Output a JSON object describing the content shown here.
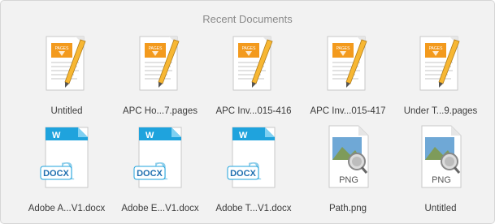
{
  "panel": {
    "title": "Recent Documents"
  },
  "documents": [
    {
      "name": "Untitled",
      "kind": "pages",
      "icon": "pages-document-icon"
    },
    {
      "name": "APC Ho...7.pages",
      "kind": "pages",
      "icon": "pages-document-icon"
    },
    {
      "name": "APC Inv...015-416",
      "kind": "pages",
      "icon": "pages-document-icon"
    },
    {
      "name": "APC Inv...015-417",
      "kind": "pages",
      "icon": "pages-document-icon"
    },
    {
      "name": "Under T...9.pages",
      "kind": "pages",
      "icon": "pages-document-icon"
    },
    {
      "name": "Adobe A...V1.docx",
      "kind": "docx",
      "icon": "word-docx-icon",
      "badge": "DOCX"
    },
    {
      "name": "Adobe E...V1.docx",
      "kind": "docx",
      "icon": "word-docx-icon",
      "badge": "DOCX"
    },
    {
      "name": "Adobe T...V1.docx",
      "kind": "docx",
      "icon": "word-docx-icon",
      "badge": "DOCX"
    },
    {
      "name": "Path.png",
      "kind": "png",
      "icon": "png-preview-icon",
      "badge": "PNG"
    },
    {
      "name": "Untitled",
      "kind": "png",
      "icon": "png-preview-icon",
      "badge": "PNG"
    }
  ],
  "colors": {
    "panel_background": "#f2f2f2",
    "pages_orange": "#f39a1d",
    "docx_blue": "#1fa3dd",
    "label_text": "#3c3c3c",
    "title_text": "#8a8a8a"
  }
}
